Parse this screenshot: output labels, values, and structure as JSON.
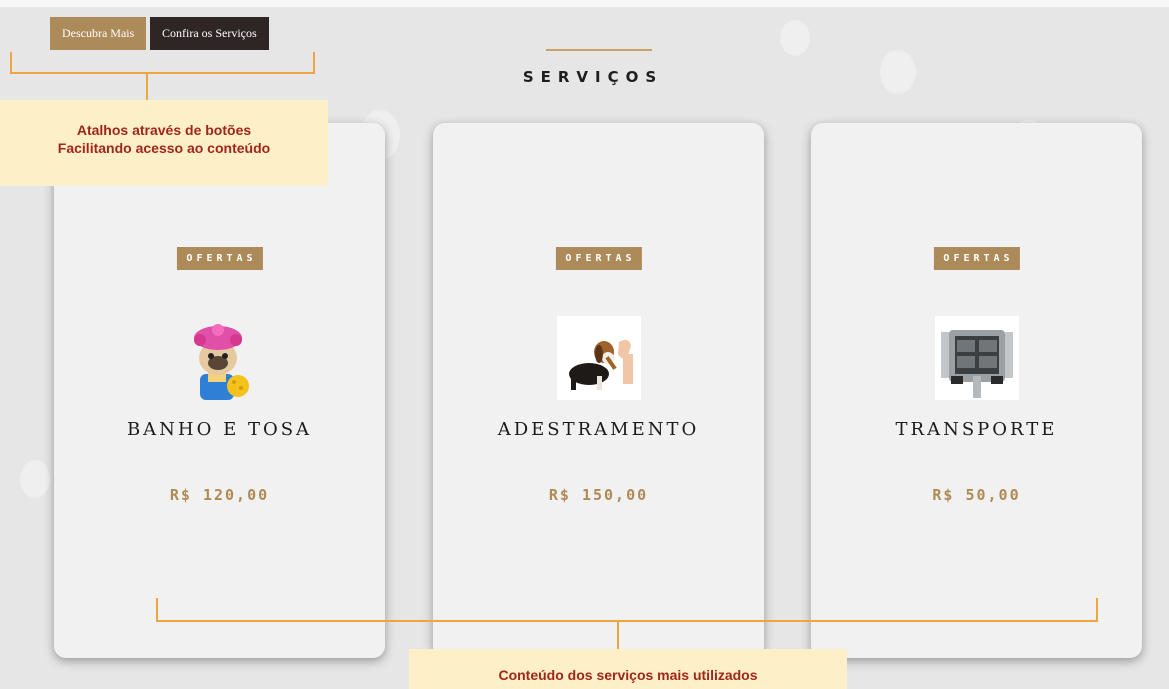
{
  "hero_buttons": {
    "discover_label": "Descubra Mais",
    "services_label": "Confira os Serviços"
  },
  "section": {
    "title": "SERVIÇOS"
  },
  "cards": [
    {
      "badge": "OFERTAS",
      "name": "BANHO E TOSA",
      "price": "R$ 120,00",
      "image": "dog-shower-cap"
    },
    {
      "badge": "OFERTAS",
      "name": "ADESTRAMENTO",
      "price": "R$ 150,00",
      "image": "dog-high-five"
    },
    {
      "badge": "OFERTAS",
      "name": "TRANSPORTE",
      "price": "R$ 50,00",
      "image": "van-rear-open"
    }
  ],
  "annotations": {
    "top_note_line1": "Atalhos através de botões",
    "top_note_line2": "Facilitando acesso ao conteúdo",
    "bottom_note": "Conteúdo dos serviços mais utilizados"
  },
  "colors": {
    "accent_gold": "#ad8a5a",
    "dark_button": "#2e2624",
    "price": "#b08a55",
    "annotation_line": "#f0a640",
    "annotation_note_bg": "#fdf0c8",
    "annotation_text": "#a0261b"
  }
}
